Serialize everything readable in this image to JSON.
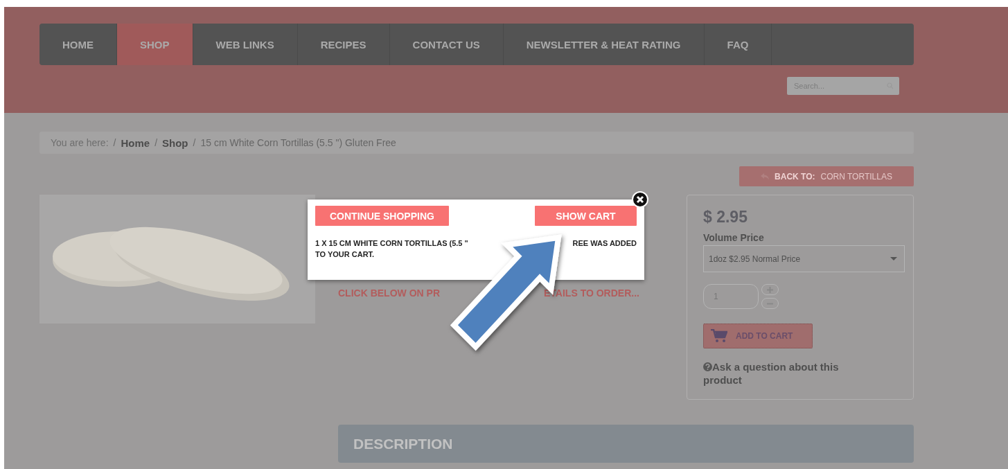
{
  "nav": [
    {
      "label": "HOME",
      "selected": false
    },
    {
      "label": "SHOP",
      "selected": true
    },
    {
      "label": "WEB LINKS",
      "selected": false
    },
    {
      "label": "RECIPES",
      "selected": false
    },
    {
      "label": "CONTACT US",
      "selected": false
    },
    {
      "label": "NEWSLETTER & HEAT RATING",
      "selected": false
    },
    {
      "label": "FAQ",
      "selected": false
    }
  ],
  "search": {
    "placeholder": "Search..."
  },
  "breadcrumb": {
    "label": "You are here:",
    "separator": "/",
    "items": [
      {
        "text": "Home",
        "kind": "link"
      },
      {
        "text": "Shop",
        "kind": "link"
      },
      {
        "text": "15 cm White Corn Tortillas (5.5 \") Gluten Free",
        "kind": "current"
      }
    ]
  },
  "back_button": {
    "prefix": "BACK TO:",
    "label": "CORN TORTILLAS"
  },
  "product": {
    "order_hint": [
      "CLICK BELOW ON PR",
      "ETAILS TO ORDER..."
    ]
  },
  "purchase": {
    "price": "$ 2.95",
    "volume_label": "Volume Price",
    "volume_value": "1doz $2.95 Normal Price",
    "quantity": "1",
    "add_to_cart": "ADD TO CART",
    "ask_question": "Ask a question about this product"
  },
  "description_tab": "DESCRIPTION",
  "popup": {
    "continue_button": "CONTINUE SHOPPING",
    "cart_button": "SHOW CART",
    "message": [
      "1 X 15 CM WHITE CORN TORTILLAS (5.5 \"",
      "REE WAS ADDED",
      "TO YOUR CART."
    ]
  }
}
